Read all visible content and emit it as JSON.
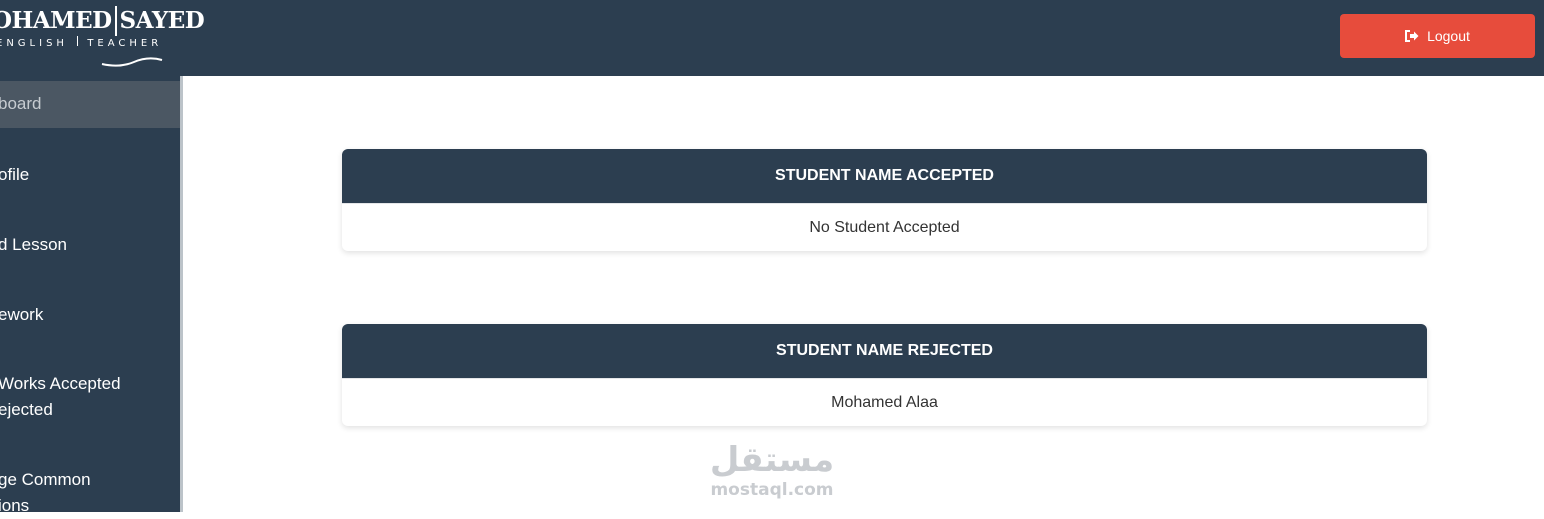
{
  "header": {
    "logo": {
      "name_left": "OHAMED",
      "name_right": "SAYED",
      "subtitle_left": "ENGLISH",
      "subtitle_right": "TEACHER"
    },
    "logout_label": "Logout",
    "logout_icon": "sign-out-icon"
  },
  "sidebar": {
    "items": [
      {
        "lines": [
          "board"
        ]
      },
      {
        "lines": [
          "ofile"
        ]
      },
      {
        "lines": [
          "d Lesson"
        ]
      },
      {
        "lines": [
          "ework"
        ]
      },
      {
        "lines": [
          "Works Accepted",
          "ejected"
        ]
      },
      {
        "lines": [
          "ge Common",
          "ions"
        ]
      }
    ]
  },
  "cards": [
    {
      "title": "STUDENT NAME ACCEPTED",
      "body": "No Student Accepted"
    },
    {
      "title": "STUDENT NAME REJECTED",
      "body": "Mohamed Alaa"
    }
  ],
  "watermark": {
    "arabic": "مستقل",
    "latin": "mostaql.com"
  },
  "colors": {
    "header_bg": "#2c3e50",
    "logout_bg": "#e74c3c",
    "active_item_bg": "#4b5763"
  }
}
